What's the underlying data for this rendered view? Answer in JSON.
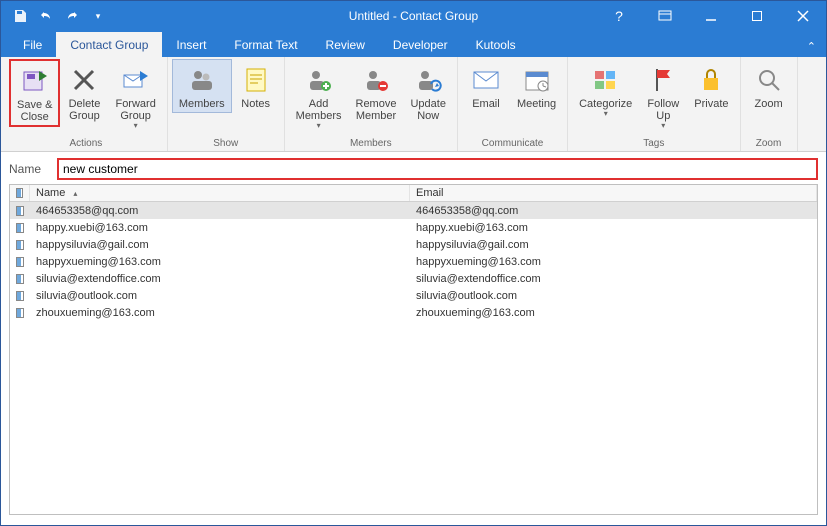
{
  "window": {
    "title": "Untitled  -  Contact Group"
  },
  "tabs": {
    "file": "File",
    "contact_group": "Contact Group",
    "insert": "Insert",
    "format_text": "Format Text",
    "review": "Review",
    "developer": "Developer",
    "kutools": "Kutools"
  },
  "ribbon": {
    "save_close_l1": "Save &",
    "save_close_l2": "Close",
    "delete_l1": "Delete",
    "delete_l2": "Group",
    "forward_l1": "Forward",
    "forward_l2": "Group",
    "members": "Members",
    "notes": "Notes",
    "add_l1": "Add",
    "add_l2": "Members",
    "remove_l1": "Remove",
    "remove_l2": "Member",
    "update_l1": "Update",
    "update_l2": "Now",
    "email": "Email",
    "meeting": "Meeting",
    "categorize": "Categorize",
    "follow_l1": "Follow",
    "follow_l2": "Up",
    "private": "Private",
    "zoom": "Zoom",
    "grp_actions": "Actions",
    "grp_show": "Show",
    "grp_members": "Members",
    "grp_communicate": "Communicate",
    "grp_tags": "Tags",
    "grp_zoom": "Zoom"
  },
  "name_field": {
    "label": "Name",
    "value": "new customer"
  },
  "columns": {
    "name": "Name",
    "email": "Email"
  },
  "contacts": [
    {
      "name": "464653358@qq.com",
      "email": "464653358@qq.com",
      "selected": true
    },
    {
      "name": "happy.xuebi@163.com",
      "email": "happy.xuebi@163.com",
      "selected": false
    },
    {
      "name": "happysiluvia@gail.com",
      "email": "happysiluvia@gail.com",
      "selected": false
    },
    {
      "name": "happyxueming@163.com",
      "email": "happyxueming@163.com",
      "selected": false
    },
    {
      "name": "siluvia@extendoffice.com",
      "email": "siluvia@extendoffice.com",
      "selected": false
    },
    {
      "name": "siluvia@outlook.com",
      "email": "siluvia@outlook.com",
      "selected": false
    },
    {
      "name": "zhouxueming@163.com",
      "email": "zhouxueming@163.com",
      "selected": false
    }
  ]
}
